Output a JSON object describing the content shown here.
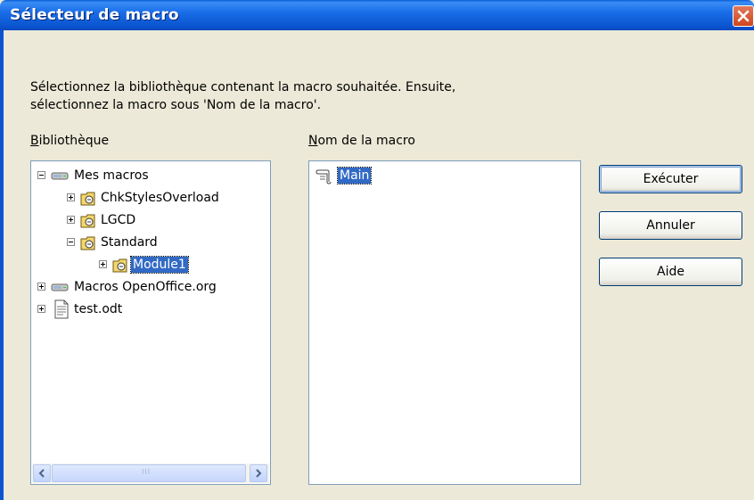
{
  "window": {
    "title": "Sélecteur de macro"
  },
  "description": {
    "line1": "Sélectionnez la bibliothèque contenant la macro souhaitée. Ensuite,",
    "line2": "sélectionnez la macro sous 'Nom de la macro'."
  },
  "library": {
    "label_mnemonic": "B",
    "label_rest": "ibliothèque",
    "tree": [
      {
        "label": "Mes macros",
        "icon": "drive-icon",
        "expanded": true,
        "level": 0
      },
      {
        "label": "ChkStylesOverload",
        "icon": "library-icon",
        "expanded": false,
        "level": 1
      },
      {
        "label": "LGCD",
        "icon": "library-icon",
        "expanded": false,
        "level": 1
      },
      {
        "label": "Standard",
        "icon": "library-icon",
        "expanded": true,
        "level": 1
      },
      {
        "label": "Module1",
        "icon": "library-icon",
        "expanded": false,
        "level": 2,
        "selected": true
      },
      {
        "label": "Macros OpenOffice.org",
        "icon": "drive-icon",
        "expanded": false,
        "level": 0
      },
      {
        "label": "test.odt",
        "icon": "document-icon",
        "expanded": false,
        "level": 0
      }
    ]
  },
  "macro_name": {
    "label_mnemonic": "N",
    "label_rest": "om de la macro",
    "items": [
      {
        "label": "Main",
        "icon": "macro-icon",
        "selected": true
      }
    ]
  },
  "buttons": {
    "run": "Exécuter",
    "cancel": "Annuler",
    "help": "Aide"
  },
  "scrollbar": {
    "grip": "III"
  },
  "colors": {
    "title_bar": "#0b55d0",
    "selection": "#316ac5",
    "dialog_bg": "#ece9d8",
    "close_button": "#d0471d"
  }
}
